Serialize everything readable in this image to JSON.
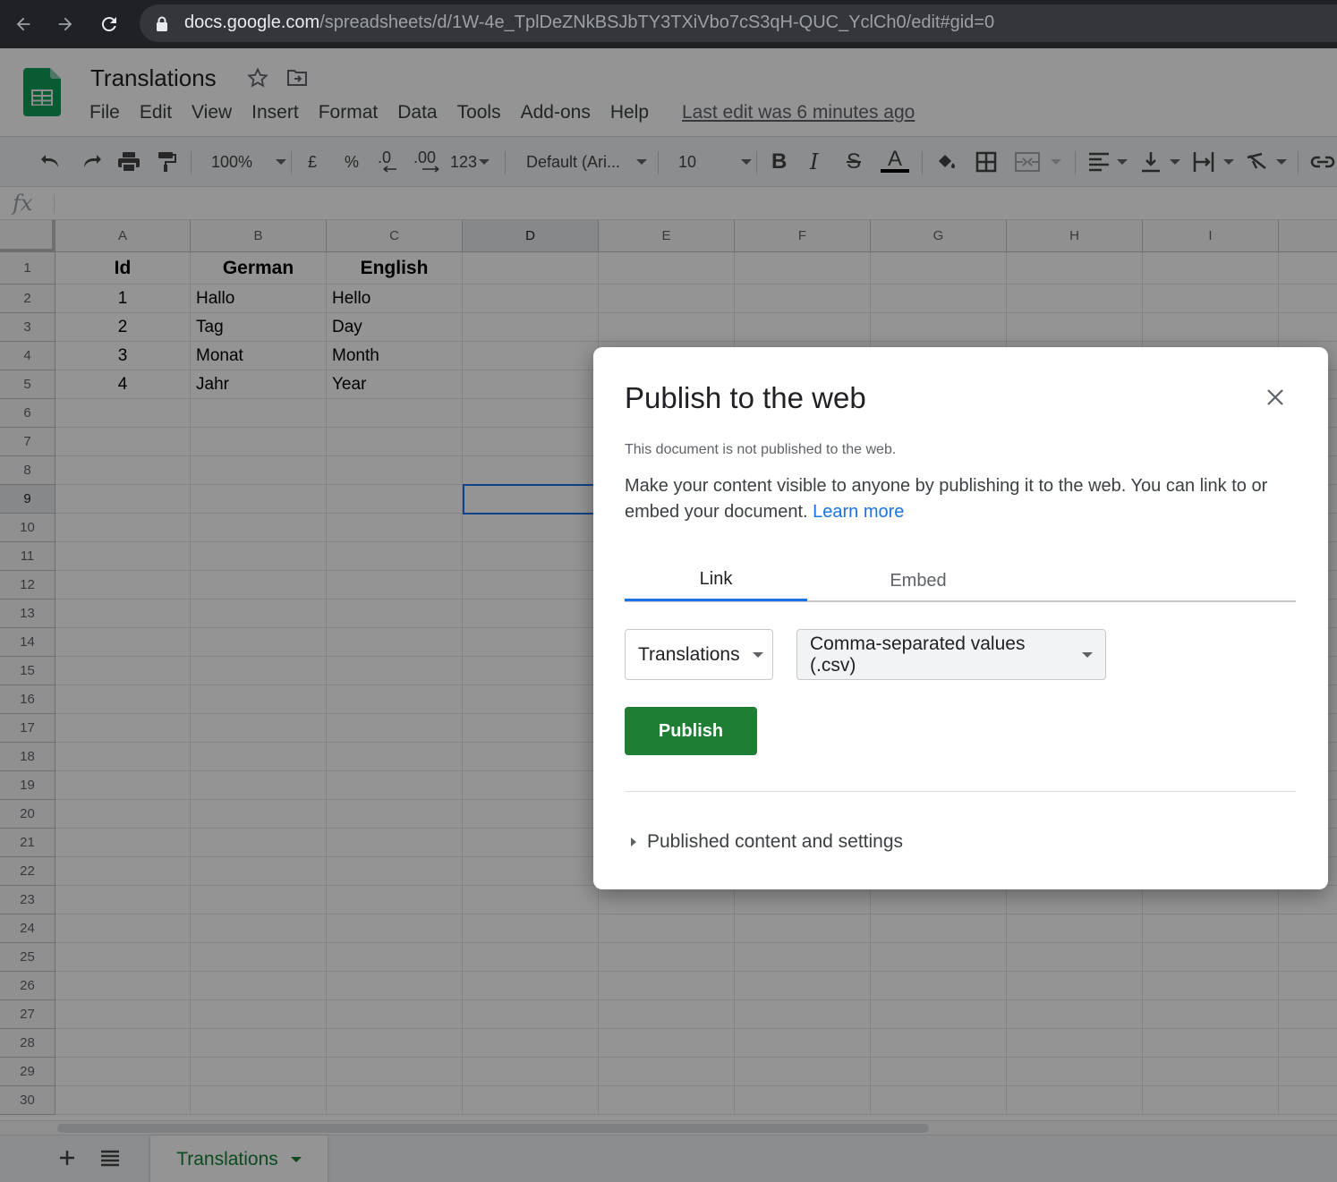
{
  "browser": {
    "url_host": "docs.google.com",
    "url_path": "/spreadsheets/d/1W-4e_TplDeZNkBSJbTY3TXiVbo7cS3qH-QUC_YclCh0/edit#gid=0"
  },
  "header": {
    "title": "Translations",
    "menu": [
      "File",
      "Edit",
      "View",
      "Insert",
      "Format",
      "Data",
      "Tools",
      "Add-ons",
      "Help"
    ],
    "last_edit": "Last edit was 6 minutes ago"
  },
  "toolbar": {
    "zoom": "100%",
    "currency": "£",
    "percent": "%",
    "decrease_decimal": ".0",
    "increase_decimal": ".00",
    "more_formats": "123",
    "font": "Default (Ari...",
    "font_size": "10",
    "bold": "B",
    "italic": "I",
    "strike": "S",
    "text_color_letter": "A"
  },
  "formula_bar": {
    "fx": "fx"
  },
  "grid": {
    "columns": [
      "A",
      "B",
      "C",
      "D",
      "E",
      "F",
      "G",
      "H",
      "I"
    ],
    "selected_column": "D",
    "selected_row": "9",
    "rows": [
      "1",
      "2",
      "3",
      "4",
      "5",
      "6",
      "7",
      "8",
      "9",
      "10",
      "11",
      "12",
      "13",
      "14",
      "15",
      "16",
      "17",
      "18",
      "19",
      "20",
      "21",
      "22",
      "23",
      "24",
      "25",
      "26",
      "27",
      "28",
      "29",
      "30"
    ],
    "headers": [
      "Id",
      "German",
      "English"
    ],
    "data": [
      [
        "1",
        "Hallo",
        "Hello"
      ],
      [
        "2",
        "Tag",
        "Day"
      ],
      [
        "3",
        "Monat",
        "Month"
      ],
      [
        "4",
        "Jahr",
        "Year"
      ]
    ]
  },
  "sheets": {
    "active_tab": "Translations"
  },
  "dialog": {
    "title": "Publish to the web",
    "status": "This document is not published to the web.",
    "description": "Make your content visible to anyone by publishing it to the web. You can link to or embed your document.",
    "learn_more": "Learn more",
    "tabs": [
      "Link",
      "Embed"
    ],
    "active_tab": "Link",
    "sheet_select": "Translations",
    "format_select": "Comma-separated values (.csv)",
    "publish_button": "Publish",
    "settings_toggle": "Published content and settings"
  },
  "colors": {
    "accent_blue": "#1a73e8",
    "publish_green": "#1e7e34",
    "sheets_green": "#188038"
  }
}
